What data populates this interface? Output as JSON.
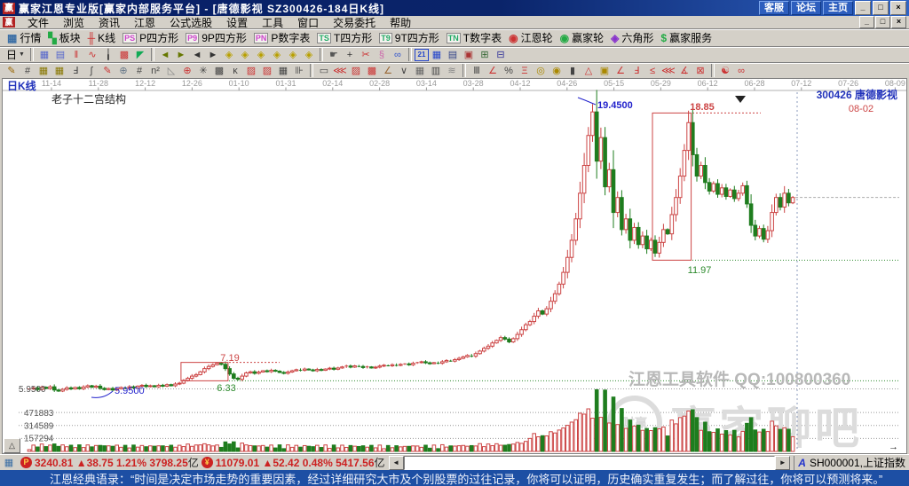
{
  "window": {
    "title": "赢家江恩专业版[赢家内部服务平台] - [唐德影视  SZ300426-184日K线]",
    "app_icon_char": "赢",
    "buttons": [
      "客服",
      "论坛",
      "主页"
    ],
    "win_controls": [
      "_",
      "□",
      "×"
    ]
  },
  "menu": {
    "items": [
      {
        "id": "file",
        "label": "文件"
      },
      {
        "id": "browse",
        "label": "浏览"
      },
      {
        "id": "news",
        "label": "资讯"
      },
      {
        "id": "gann",
        "label": "江恩"
      },
      {
        "id": "formula-pick",
        "label": "公式选股"
      },
      {
        "id": "settings",
        "label": "设置"
      },
      {
        "id": "tools",
        "label": "工具"
      },
      {
        "id": "window",
        "label": "窗口"
      },
      {
        "id": "trade",
        "label": "交易委托"
      },
      {
        "id": "help",
        "label": "帮助"
      }
    ],
    "win_controls": [
      "_",
      "□",
      "×"
    ]
  },
  "toolbar1": {
    "items": [
      {
        "id": "quotes",
        "glyph": "▦",
        "color": "#3a6ea5",
        "label": "行情"
      },
      {
        "id": "sectors",
        "glyph": "▚",
        "color": "#22aa44",
        "label": "板块"
      },
      {
        "id": "kline",
        "glyph": "╫",
        "color": "#cc3333",
        "label": "K线"
      },
      {
        "id": "p-square",
        "badge": "PS",
        "color": "#cc44cc",
        "label": "P四方形"
      },
      {
        "id": "9p-square",
        "badge": "P9",
        "color": "#cc44cc",
        "label": "9P四方形"
      },
      {
        "id": "p-table",
        "badge": "PN",
        "color": "#cc44cc",
        "label": "P数字表"
      },
      {
        "id": "t-square",
        "badge": "TS",
        "color": "#22aa66",
        "label": "T四方形"
      },
      {
        "id": "9t-square",
        "badge": "T9",
        "color": "#22aa66",
        "label": "9T四方形"
      },
      {
        "id": "t-table",
        "badge": "TN",
        "color": "#22aa66",
        "label": "T数字表"
      },
      {
        "id": "gann-wheel",
        "glyph": "◉",
        "color": "#cc3333",
        "label": "江恩轮"
      },
      {
        "id": "winner-wheel",
        "glyph": "◉",
        "color": "#22aa44",
        "label": "赢家轮"
      },
      {
        "id": "hexagon",
        "glyph": "◈",
        "color": "#8833cc",
        "label": "六角形"
      },
      {
        "id": "winner-service",
        "glyph": "$",
        "color": "#22aa44",
        "label": "赢家服务"
      }
    ]
  },
  "toolbar2": {
    "period": {
      "id": "period-day-dropdown",
      "label": "日"
    },
    "items": [
      {
        "id": "chart-window",
        "g": "▦",
        "c": "#5566cc"
      },
      {
        "id": "info-panel",
        "g": "▤",
        "c": "#5566cc"
      },
      {
        "id": "bar-chart",
        "g": "‖",
        "c": "#cc3333"
      },
      {
        "id": "zigzag-line",
        "g": "∿",
        "c": "#cc3333"
      },
      {
        "id": "candle-style",
        "g": "╽",
        "c": "#333333"
      },
      {
        "id": "coordinate",
        "g": "▩",
        "c": "#cc3333"
      },
      {
        "id": "draw-flag",
        "g": "◤",
        "c": "#11aa55"
      },
      {
        "id": "sep1",
        "sep": true
      },
      {
        "id": "go-first",
        "g": "◄",
        "c": "#667700"
      },
      {
        "id": "go-last",
        "g": "►",
        "c": "#667700"
      },
      {
        "id": "step-back",
        "g": "◄",
        "c": "#333333"
      },
      {
        "id": "step-forward",
        "g": "►",
        "c": "#333333"
      },
      {
        "id": "diamond-tool-1",
        "g": "◈",
        "c": "#b8a000"
      },
      {
        "id": "diamond-tool-2",
        "g": "◈",
        "c": "#b8a000"
      },
      {
        "id": "diamond-tool-3",
        "g": "◈",
        "c": "#b8a000"
      },
      {
        "id": "diamond-tool-4",
        "g": "◈",
        "c": "#b8a000"
      },
      {
        "id": "diamond-tool-5",
        "g": "◈",
        "c": "#b8a000"
      },
      {
        "id": "diamond-tool-6",
        "g": "◈",
        "c": "#b8a000"
      },
      {
        "id": "sep2",
        "sep": true
      },
      {
        "id": "hand-tool",
        "g": "☛",
        "c": "#555555"
      },
      {
        "id": "crosshair",
        "g": "+",
        "c": "#333333"
      },
      {
        "id": "cut-tool",
        "g": "✂",
        "c": "#cc3333"
      },
      {
        "id": "brush-tool",
        "g": "§",
        "c": "#cc66aa"
      },
      {
        "id": "magnifier",
        "g": "∞",
        "c": "#3355cc"
      },
      {
        "id": "sep3",
        "sep": true
      },
      {
        "id": "calendar",
        "g": "21",
        "c": "#2244cc",
        "badge": true
      },
      {
        "id": "calculator",
        "g": "▦",
        "c": "#2244cc"
      },
      {
        "id": "notes",
        "g": "▤",
        "c": "#334488"
      },
      {
        "id": "save",
        "g": "▣",
        "c": "#aa3333"
      },
      {
        "id": "export",
        "g": "⊞",
        "c": "#336633"
      },
      {
        "id": "print",
        "g": "⊟",
        "c": "#333399"
      }
    ]
  },
  "toolbar3": {
    "groups": [
      [
        {
          "id": "angle-pen",
          "g": "✎",
          "c": "#996600"
        },
        {
          "id": "hash-grid",
          "g": "#",
          "c": "#444444"
        },
        {
          "id": "gann-grid-1",
          "g": "▦",
          "c": "#887700"
        },
        {
          "id": "gann-grid-2",
          "g": "▦",
          "c": "#887700"
        },
        {
          "id": "t-ruler",
          "g": "Ⅎ",
          "c": "#444444"
        },
        {
          "id": "arc-tool",
          "g": "ʃ",
          "c": "#444444"
        },
        {
          "id": "red-pen",
          "g": "✎",
          "c": "#cc3333"
        },
        {
          "id": "circle-cross",
          "g": "⊕",
          "c": "#667788"
        },
        {
          "id": "dense-grid",
          "g": "#",
          "c": "#444444"
        },
        {
          "id": "n-square",
          "g": "n²",
          "c": "#444444"
        },
        {
          "id": "triangle-ruler",
          "g": "◺",
          "c": "#888888"
        },
        {
          "id": "red-target",
          "g": "⊕",
          "c": "#cc3333"
        },
        {
          "id": "star-tool",
          "g": "✳",
          "c": "#444444"
        },
        {
          "id": "box-grid",
          "g": "▩",
          "c": "#444444"
        },
        {
          "id": "k-mark",
          "g": "ĸ",
          "c": "#444444"
        },
        {
          "id": "red-grid-1",
          "g": "▨",
          "c": "#cc3333"
        },
        {
          "id": "red-grid-2",
          "g": "▨",
          "c": "#cc3333"
        },
        {
          "id": "dark-grid",
          "g": "▦",
          "c": "#444444"
        },
        {
          "id": "bar-pair",
          "g": "⊪",
          "c": "#444444"
        }
      ],
      [
        {
          "id": "frame-tool",
          "g": "▭",
          "c": "#444444"
        },
        {
          "id": "fan-lines",
          "g": "⋘",
          "c": "#cc3333"
        },
        {
          "id": "red-hatch-1",
          "g": "▨",
          "c": "#cc3333"
        },
        {
          "id": "red-hatch-2",
          "g": "▩",
          "c": "#cc3333"
        },
        {
          "id": "angle-line",
          "g": "∠",
          "c": "#996633"
        },
        {
          "id": "v-line",
          "g": "∨",
          "c": "#444444"
        },
        {
          "id": "mid-grid",
          "g": "▦",
          "c": "#666666"
        },
        {
          "id": "half-grid",
          "g": "▥",
          "c": "#444444"
        },
        {
          "id": "wave-lines",
          "g": "≋",
          "c": "#888888"
        }
      ],
      [
        {
          "id": "bars-tool",
          "g": "Ⅲ",
          "c": "#444444"
        },
        {
          "id": "percent-angle",
          "g": "∠",
          "c": "#cc3333"
        },
        {
          "id": "percent-tool",
          "g": "%",
          "c": "#444444"
        },
        {
          "id": "percent-levels",
          "g": "Ξ",
          "c": "#cc3333"
        },
        {
          "id": "gold-circle-1",
          "g": "◎",
          "c": "#aa8800"
        },
        {
          "id": "gold-circle-2",
          "g": "◉",
          "c": "#aa8800"
        },
        {
          "id": "candle-pen",
          "g": "▮",
          "c": "#444444"
        },
        {
          "id": "red-triangle",
          "g": "△",
          "c": "#cc3333"
        },
        {
          "id": "gold-box",
          "g": "▣",
          "c": "#aa8800"
        },
        {
          "id": "red-angle-y",
          "g": "∠",
          "c": "#cc3333"
        },
        {
          "id": "f-angle",
          "g": "Ⅎ",
          "c": "#cc3333"
        },
        {
          "id": "le-angle",
          "g": "≤",
          "c": "#cc3333"
        },
        {
          "id": "speed-lines",
          "g": "⋘",
          "c": "#cc3333"
        },
        {
          "id": "slope-tool",
          "g": "∡",
          "c": "#cc3333"
        },
        {
          "id": "cross-box",
          "g": "⊠",
          "c": "#cc3333"
        }
      ],
      [
        {
          "id": "yinyang-tool",
          "g": "☯",
          "c": "#cc3333"
        },
        {
          "id": "infinity-tool",
          "g": "∞",
          "c": "#cc3333"
        }
      ]
    ]
  },
  "chart_data": {
    "type": "candlestick+volume",
    "symbol": "300426",
    "stock_name": "唐德影视",
    "period_label": "日K线",
    "last_date": "08-02",
    "structure_label": "老子十二宫结构",
    "x_dates": [
      "11-14",
      "11-28",
      "12-12",
      "12-26",
      "01-10",
      "01-31",
      "02-14",
      "02-28",
      "03-14",
      "03-28",
      "04-12",
      "04-26",
      "05-15",
      "05-29",
      "06-12",
      "06-28",
      "07-12",
      "07-26",
      "08-09"
    ],
    "closes": [
      5.95,
      6.0,
      5.92,
      6.03,
      5.97,
      6.05,
      5.9,
      5.85,
      5.93,
      6.0,
      5.95,
      6.02,
      5.96,
      6.04,
      6.1,
      6.03,
      6.08,
      5.98,
      5.92,
      5.97,
      5.9,
      5.96,
      6.02,
      5.98,
      6.05,
      6.0,
      6.08,
      6.12,
      6.06,
      6.1,
      6.05,
      6.12,
      6.08,
      6.15,
      6.1,
      6.18,
      6.22,
      6.35,
      6.45,
      6.55,
      6.62,
      6.75,
      6.9,
      7.0,
      7.08,
      7.15,
      7.1,
      6.9,
      6.65,
      6.45,
      6.4,
      6.55,
      6.7,
      6.75,
      6.68,
      6.74,
      6.8,
      6.76,
      6.82,
      6.78,
      6.72,
      6.68,
      6.74,
      6.8,
      6.85,
      6.82,
      6.88,
      6.84,
      6.8,
      6.86,
      6.82,
      6.88,
      6.92,
      6.87,
      6.93,
      6.98,
      7.02,
      6.97,
      7.03,
      7.0,
      6.95,
      6.98,
      6.93,
      6.97,
      7.02,
      7.06,
      7.03,
      7.08,
      7.05,
      7.1,
      7.12,
      7.08,
      7.15,
      7.18,
      7.22,
      7.17,
      7.13,
      7.18,
      7.15,
      7.22,
      7.28,
      7.25,
      7.32,
      7.38,
      7.45,
      7.52,
      7.48,
      7.6,
      7.72,
      7.85,
      7.95,
      8.1,
      8.22,
      8.35,
      8.28,
      8.15,
      8.3,
      8.5,
      8.72,
      8.95,
      9.1,
      9.35,
      9.6,
      9.45,
      9.7,
      10.05,
      10.4,
      10.85,
      11.4,
      12.1,
      12.9,
      13.9,
      15.1,
      16.4,
      17.8,
      18.9,
      16.6,
      17.7,
      15.4,
      16.2,
      14.2,
      14.9,
      13.4,
      13.9,
      12.9,
      13.5,
      12.7,
      13.1,
      12.5,
      12.9,
      12.3,
      12.8,
      13.4,
      13.2,
      14.1,
      14.9,
      15.9,
      17.1,
      18.4,
      16.9,
      15.9,
      16.4,
      15.6,
      15.2,
      15.55,
      15.05,
      15.35,
      14.95,
      15.25,
      14.85,
      15.1,
      15.45,
      14.6,
      13.6,
      13.1,
      13.45,
      12.95,
      13.35,
      14.2,
      14.9,
      14.45,
      15.1,
      14.65,
      14.9
    ],
    "volume_gridlines": [
      "471883",
      "314589",
      "157294"
    ],
    "annotations": {
      "peak_label": "19.4500",
      "second_peak_label": "18.85",
      "box_low_label": "11.97",
      "left_box_high_label": "7.19",
      "left_box_low_label": "6.33",
      "base_label": "5.9500",
      "base_label_blue": "5.9500",
      "marker": "▼",
      "scroll_hint": "→"
    },
    "boxes": [
      {
        "i1": 150,
        "i2": 158,
        "p_low": 11.97,
        "p_high": 18.85
      },
      {
        "i1": 37,
        "i2": 47,
        "p_low": 6.33,
        "p_high": 7.19
      }
    ],
    "watermark_line": "江恩工具软件  QQ:100800360",
    "watermark_big": "赢家聊吧",
    "watermark_seal": "财赢",
    "colors": {
      "up": "#cc4444",
      "down": "#1e7d1e",
      "blue_note": "#2222cc",
      "green_note": "#2e8b2e",
      "box": "#cc4444"
    }
  },
  "statusbar": {
    "grid_icon": "▦",
    "sh_index": {
      "coin": "P",
      "value": "3240.81",
      "change": "▲38.75",
      "pct": "1.21%",
      "amount": "3798.25",
      "unit": "亿"
    },
    "sz_index": {
      "coin": "¥",
      "value": "11079.01",
      "change": "▲52.42",
      "pct": "0.48%",
      "amount": "5417.56",
      "unit": "亿"
    },
    "scroll": {
      "left": "◄",
      "right": "►"
    },
    "right": {
      "marker": "A",
      "label": "SH000001,上证指数"
    }
  },
  "quotebar": {
    "text": "江恩经典语录：“时间是决定市场走势的重要因素，经过详细研究大市及个别股票的过往记录，你将可以证明，历史确实重复发生；而了解过往，你将可以预测将来。”"
  }
}
